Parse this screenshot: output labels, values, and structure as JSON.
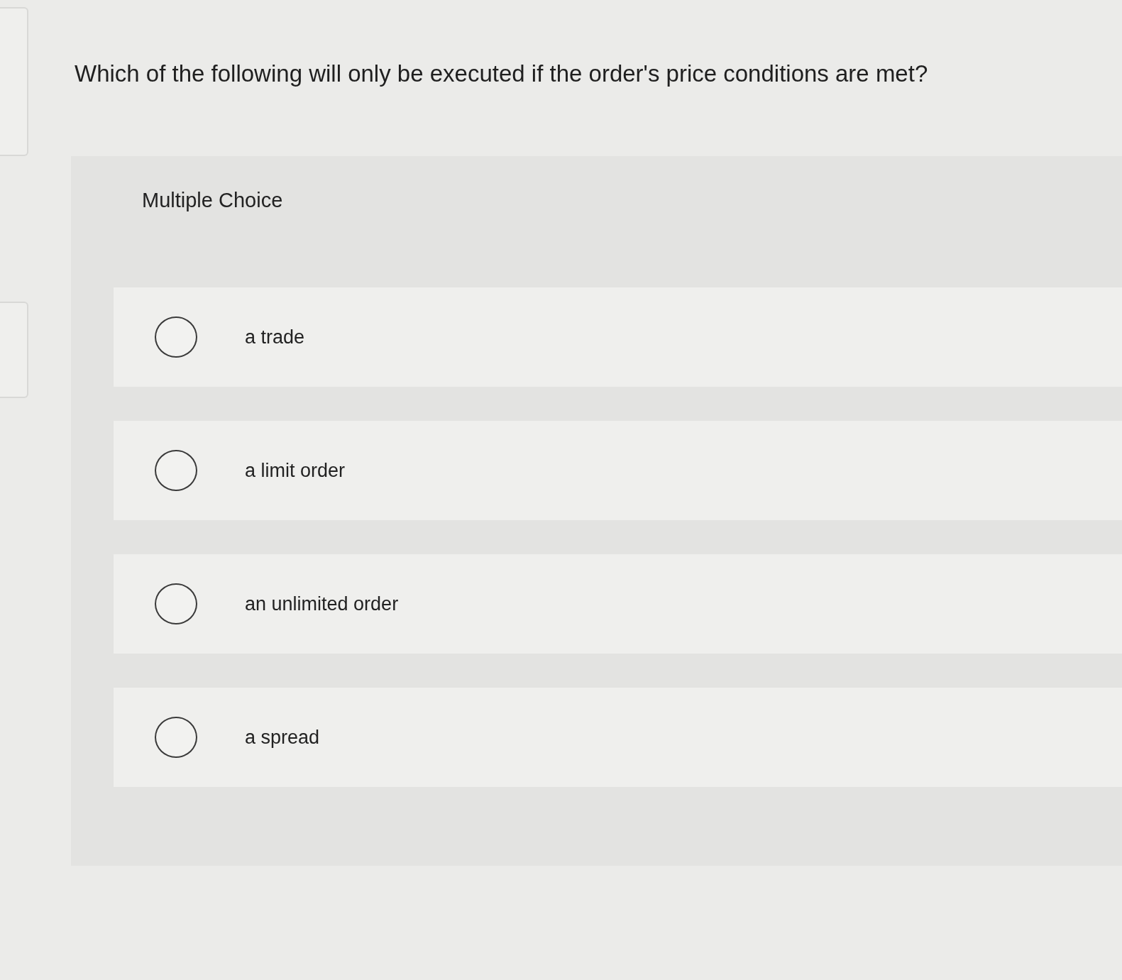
{
  "question": "Which of the following will only be executed if the order's price conditions are met?",
  "panel": {
    "label": "Multiple Choice",
    "options": [
      {
        "text": "a trade",
        "selected": false
      },
      {
        "text": "a limit order",
        "selected": false
      },
      {
        "text": "an unlimited order",
        "selected": false
      },
      {
        "text": "a spread",
        "selected": false
      }
    ]
  }
}
